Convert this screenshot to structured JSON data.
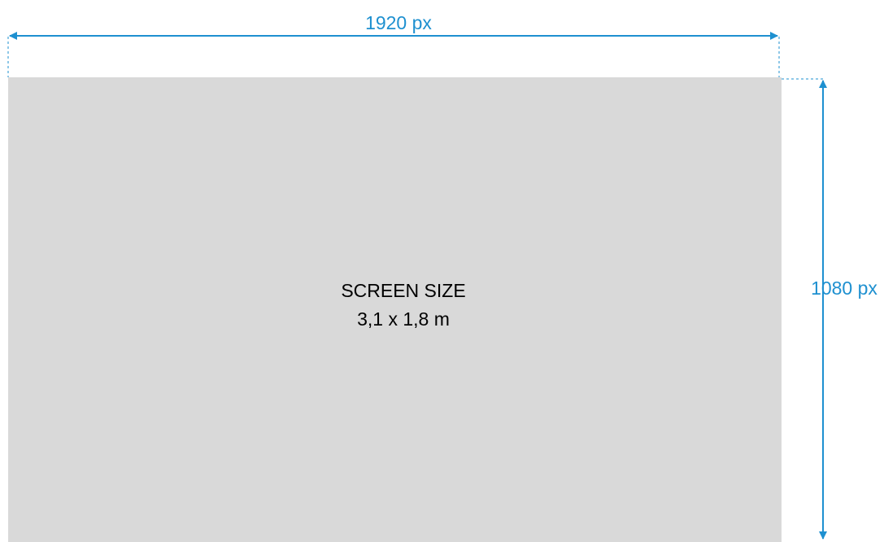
{
  "width_dimension": {
    "label": "1920 px"
  },
  "height_dimension": {
    "label": "1080 px"
  },
  "screen": {
    "title": "SCREEN SIZE",
    "size_text": "3,1 x 1,8 m"
  },
  "colors": {
    "dimension": "#1e90d0",
    "screen_fill": "#d9d9d9",
    "text": "#000000"
  }
}
